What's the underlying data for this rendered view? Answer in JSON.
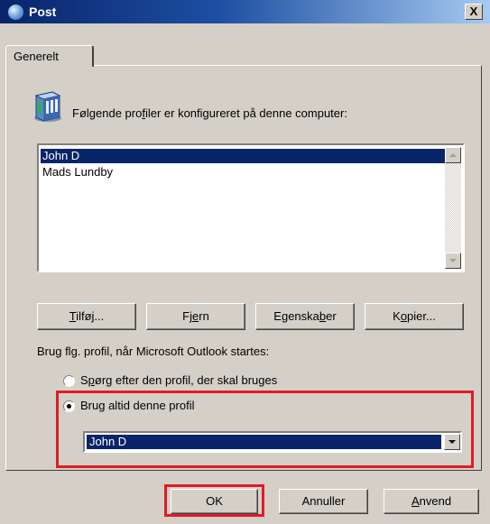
{
  "window": {
    "title": "Post",
    "close_symbol": "X"
  },
  "tabs": [
    {
      "label": "Generelt"
    }
  ],
  "intro": {
    "icon": "profiles-icon",
    "text_parts": [
      "Følgende pro",
      "f",
      "iler er konfigureret på denne computer:"
    ]
  },
  "profiles": {
    "items": [
      "John D",
      "Mads Lundby"
    ],
    "selected": "John D"
  },
  "profile_buttons": {
    "add": [
      "",
      "T",
      "ilføj..."
    ],
    "remove": [
      "Fj",
      "e",
      "rn"
    ],
    "properties": [
      "Egenska",
      "b",
      "er"
    ],
    "copy": [
      "K",
      "o",
      "pier..."
    ]
  },
  "startup": {
    "label": "Brug flg. profil, når Microsoft Outlook startes:",
    "option_ask": [
      "S",
      "p",
      "ørg efter den profil, der skal bruges"
    ],
    "option_always": [
      "Bru",
      "g",
      " altid denne profil"
    ],
    "selected_option": "always",
    "selected_profile": "John D"
  },
  "dialog_buttons": {
    "ok": "OK",
    "cancel": "Annuller",
    "apply": [
      "",
      "A",
      "nvend"
    ]
  },
  "colors": {
    "highlight": "#e31b23",
    "selection": "#0a246a",
    "face": "#d4d0c8"
  }
}
